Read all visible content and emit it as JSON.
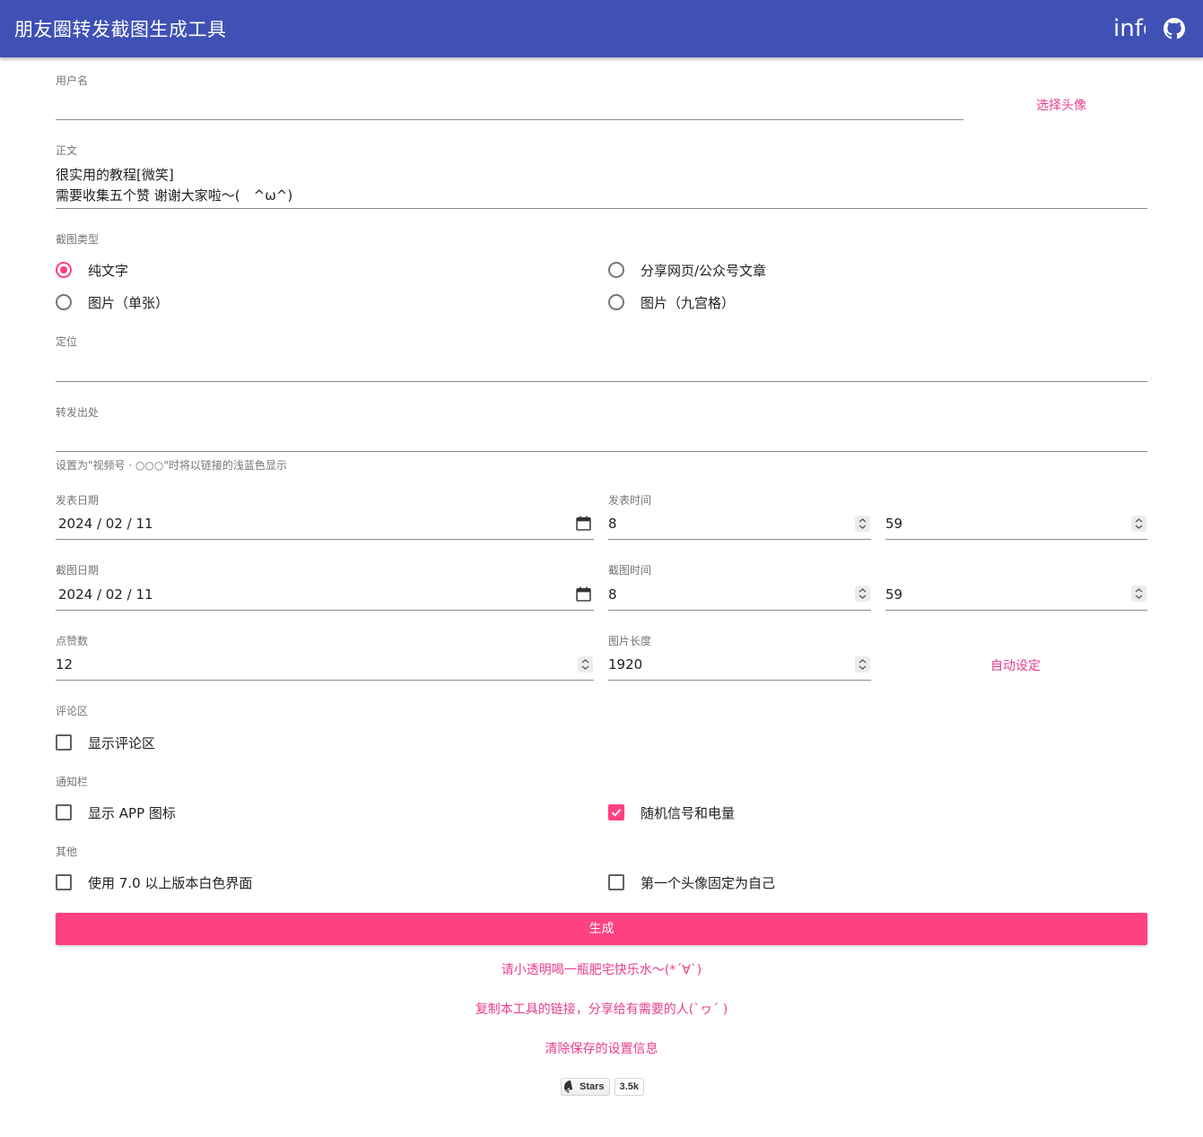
{
  "header": {
    "title": "朋友圈转发截图生成工具",
    "info_label": "info"
  },
  "username": {
    "label": "用户名",
    "value": "",
    "avatar_button": "选择头像"
  },
  "body_text": {
    "label": "正文",
    "line1": "很实用的教程[微笑]",
    "line2": "需要收集五个赞 谢谢大家啦～(　^ω^)"
  },
  "screenshot_type": {
    "label": "截图类型",
    "options": [
      {
        "label": "纯文字",
        "selected": true
      },
      {
        "label": "分享网页/公众号文章",
        "selected": false
      },
      {
        "label": "图片（单张）",
        "selected": false
      },
      {
        "label": "图片（九宫格）",
        "selected": false
      }
    ]
  },
  "location": {
    "label": "定位",
    "value": ""
  },
  "forward_source": {
    "label": "转发出处",
    "value": "",
    "helper": "设置为\"视频号 · ○○○\"时将以链接的浅蓝色显示"
  },
  "publish": {
    "date_label": "发表日期",
    "date_value": "2024 / 02 / 11",
    "time_label": "发表时间",
    "hour": "8",
    "minute": "59"
  },
  "capture": {
    "date_label": "截图日期",
    "date_value": "2024 / 02 / 11",
    "time_label": "截图时间",
    "hour": "8",
    "minute": "59"
  },
  "likes": {
    "label": "点赞数",
    "value": "12"
  },
  "image_length": {
    "label": "图片长度",
    "value": "1920",
    "auto_button": "自动设定"
  },
  "comments": {
    "label": "评论区",
    "show_label": "显示评论区",
    "checked": false
  },
  "notification": {
    "label": "通知栏",
    "app_icon_label": "显示 APP 图标",
    "app_icon_checked": false,
    "random_signal_label": "随机信号和电量",
    "random_signal_checked": true
  },
  "other": {
    "label": "其他",
    "white_ui_label": "使用 7.0 以上版本白色界面",
    "white_ui_checked": false,
    "fixed_avatar_label": "第一个头像固定为自己",
    "fixed_avatar_checked": false
  },
  "generate_button": "生成",
  "links": {
    "donate": "请小透明喝一瓶肥宅快乐水～(*´∀`)",
    "share": "复制本工具的链接，分享给有需要的人(`ヮ´ )",
    "clear": "清除保存的设置信息"
  },
  "github_badge": {
    "label": "Stars",
    "count": "3.5k"
  },
  "colors": {
    "primary": "#3f51b5",
    "accent": "#ff4081",
    "link": "#e83e8c"
  }
}
